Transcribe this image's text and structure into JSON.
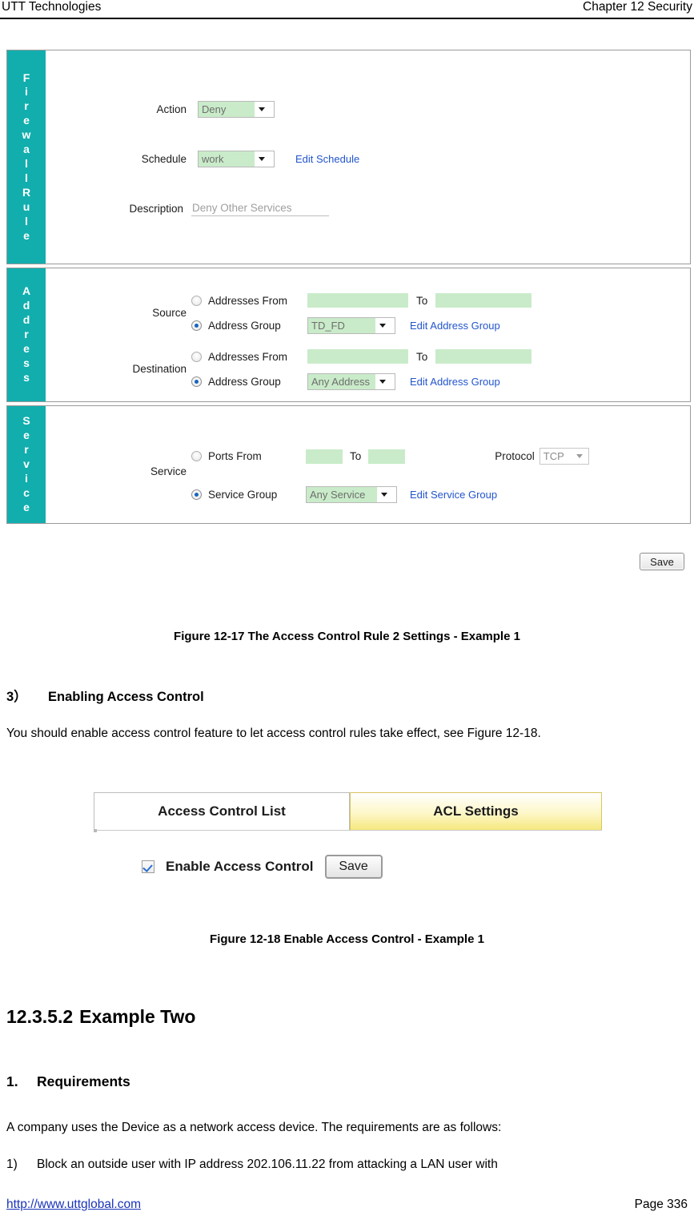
{
  "header": {
    "left": "UTT Technologies",
    "right": "Chapter 12 Security"
  },
  "screenshot_rule": {
    "sections": [
      {
        "tab_label": "Firewall Rule",
        "letters": [
          "F",
          "i",
          "r",
          "e",
          "w",
          "a",
          "l",
          "l",
          "R",
          "u",
          "l",
          "e"
        ]
      },
      {
        "tab_label": "Address",
        "letters": [
          "A",
          "d",
          "d",
          "r",
          "e",
          "s",
          "s"
        ]
      },
      {
        "tab_label": "Service",
        "letters": [
          "S",
          "e",
          "r",
          "v",
          "i",
          "c",
          "e"
        ]
      }
    ],
    "firewall": {
      "action_label": "Action",
      "action_value": "Deny",
      "schedule_label": "Schedule",
      "schedule_value": "work",
      "edit_schedule_link": "Edit Schedule",
      "description_label": "Description",
      "description_value": "Deny Other Services"
    },
    "address": {
      "source_label": "Source",
      "destination_label": "Destination",
      "addresses_from_label": "Addresses From",
      "address_group_label": "Address Group",
      "to_label": "To",
      "edit_address_group_link": "Edit Address Group",
      "source_from_value": "",
      "source_to_value": "",
      "source_group_value": "TD_FD",
      "dest_from_value": "",
      "dest_to_value": "",
      "dest_group_value": "Any Address",
      "source_selected": "address_group",
      "dest_selected": "address_group"
    },
    "service": {
      "service_label": "Service",
      "ports_from_label": "Ports From",
      "to_label": "To",
      "service_group_label": "Service Group",
      "protocol_label": "Protocol",
      "protocol_value": "TCP",
      "ports_from_value": "",
      "ports_to_value": "",
      "service_group_value": "Any Service",
      "edit_service_group_link": "Edit Service Group",
      "selected": "service_group"
    },
    "save_label": "Save"
  },
  "figure_17_caption": "Figure 12-17 The Access Control Rule 2 Settings - Example 1",
  "section_3": {
    "number": "3）",
    "title": "Enabling Access Control",
    "paragraph": "You should enable access control feature to let access control rules take effect, see Figure 12-18."
  },
  "screenshot_acl": {
    "tab_list_label": "Access Control List",
    "tab_settings_label": "ACL Settings",
    "enable_label": "Enable Access Control",
    "enable_checked": true,
    "save_label": "Save"
  },
  "figure_18_caption": "Figure 12-18 Enable Access Control - Example 1",
  "section_example_two": {
    "number": "12.3.5.2",
    "title": "Example Two"
  },
  "requirements": {
    "number": "1.",
    "title": "Requirements",
    "intro": "A company uses the Device as a network access device. The requirements are as follows:",
    "item_1_number": "1)",
    "item_1_text": "Block an outside user with IP address 202.106.11.22 from attacking a LAN user with"
  },
  "footer": {
    "url": "http://www.uttglobal.com",
    "page": "Page 336"
  },
  "colors": {
    "tab_teal": "#12aeae",
    "field_green": "#c9ebc9",
    "link_blue": "#2255cc",
    "tab_yellow": "#f6e87f"
  }
}
